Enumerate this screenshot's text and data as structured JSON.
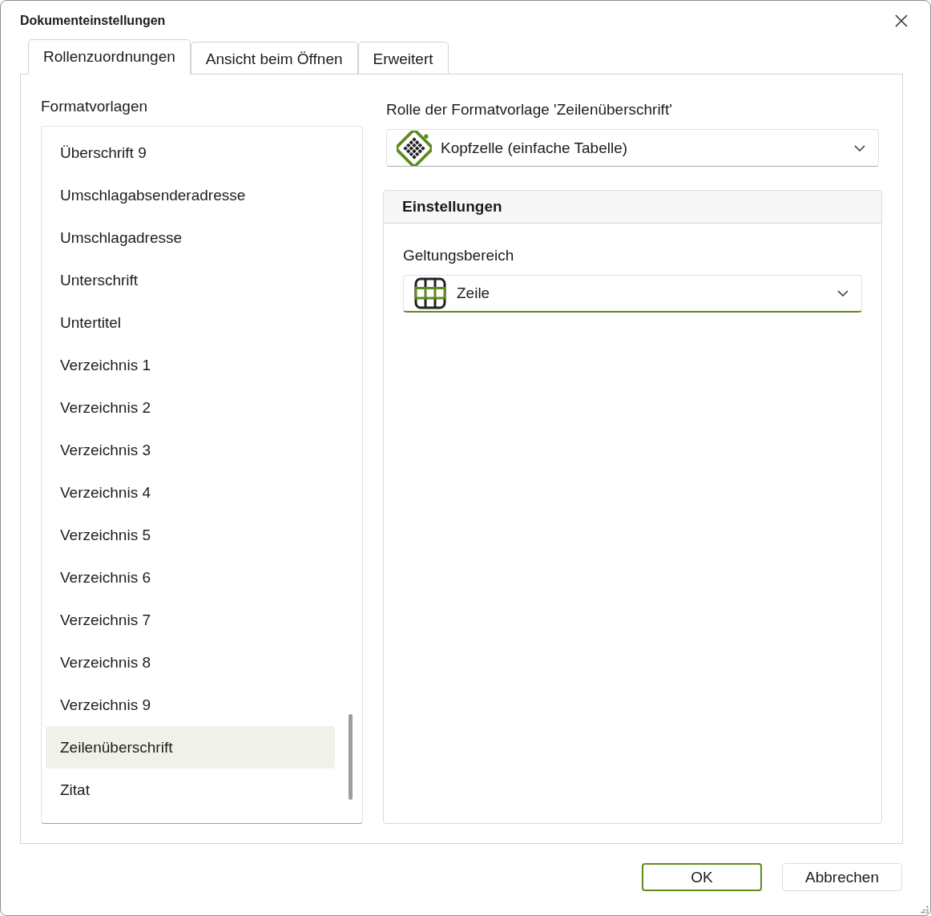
{
  "window": {
    "title": "Dokumenteinstellungen"
  },
  "tabs": [
    {
      "label": "Rollenzuordnungen",
      "selected": true
    },
    {
      "label": "Ansicht beim Öffnen",
      "selected": false
    },
    {
      "label": "Erweitert",
      "selected": false
    }
  ],
  "styles_list": {
    "label": "Formatvorlagen",
    "items": [
      {
        "label": "Überschrift 9",
        "selected": false
      },
      {
        "label": "Umschlagabsenderadresse",
        "selected": false
      },
      {
        "label": "Umschlagadresse",
        "selected": false
      },
      {
        "label": "Unterschrift",
        "selected": false
      },
      {
        "label": "Untertitel",
        "selected": false
      },
      {
        "label": "Verzeichnis 1",
        "selected": false
      },
      {
        "label": "Verzeichnis 2",
        "selected": false
      },
      {
        "label": "Verzeichnis 3",
        "selected": false
      },
      {
        "label": "Verzeichnis 4",
        "selected": false
      },
      {
        "label": "Verzeichnis 5",
        "selected": false
      },
      {
        "label": "Verzeichnis 6",
        "selected": false
      },
      {
        "label": "Verzeichnis 7",
        "selected": false
      },
      {
        "label": "Verzeichnis 8",
        "selected": false
      },
      {
        "label": "Verzeichnis 9",
        "selected": false
      },
      {
        "label": "Zeilenüberschrift",
        "selected": true
      },
      {
        "label": "Zitat",
        "selected": false
      }
    ]
  },
  "role": {
    "label": "Rolle der Formatvorlage 'Zeilenüberschrift'",
    "value": "Kopfzelle (einfache Tabelle)"
  },
  "settings": {
    "title": "Einstellungen",
    "scope": {
      "label": "Geltungsbereich",
      "value": "Zeile"
    }
  },
  "buttons": [
    {
      "label": "OK",
      "kind": "primary"
    },
    {
      "label": "Abbrechen",
      "kind": "secondary"
    }
  ]
}
